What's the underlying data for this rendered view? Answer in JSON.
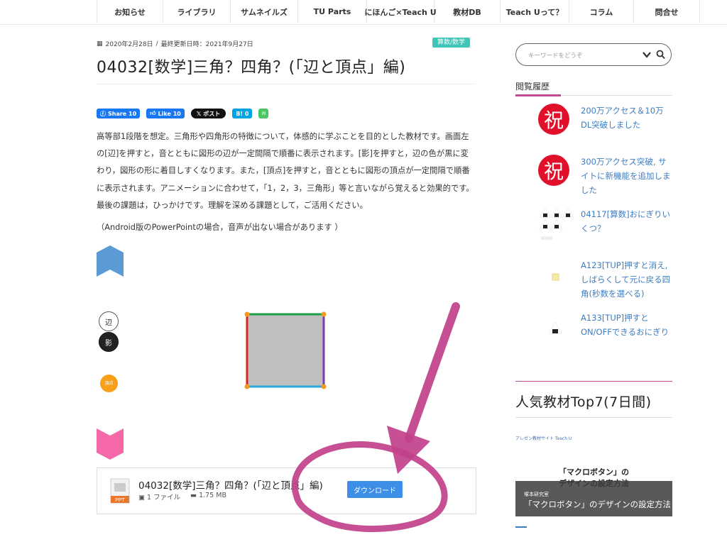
{
  "nav": {
    "items": [
      {
        "label": "お知らせ",
        "w": 92
      },
      {
        "label": "ライブラリ",
        "w": 94
      },
      {
        "label": "サムネイルズ",
        "w": 94
      },
      {
        "label": "TU Parts",
        "w": 96
      },
      {
        "label": "にほんご×Teach U",
        "w": 94
      },
      {
        "label": "教材DB",
        "w": 92
      },
      {
        "label": "Teach Uって？",
        "w": 96
      },
      {
        "label": "コラム",
        "w": 90
      },
      {
        "label": "問合せ",
        "w": 92
      }
    ]
  },
  "post": {
    "date": "2020年2月28日",
    "updated": "最終更新日時：2021年9月27日",
    "category": "算数/数学",
    "title": "04032[数学]三角？四角？(「辺と頂点」編)",
    "description": "高等部1段階を想定。三角形や四角形の特徴について，体感的に学ぶことを目的とした教材です。画面左の[辺]を押すと，音とともに図形の辺が一定間隔で順番に表示されます。[影]を押すと，辺の色が黒に変わり，図形の形に着目しすくなります。また，[頂点]を押すと，音とともに図形の頂点が一定間隔で順番に表示されます。アニメーションに合わせて，「1，2，3，三角形」等と言いながら覚えると効果的です。最後の課題は，ひっかけです。理解を深める課題として，ご活用ください。",
    "note": "（Android版のPowerPointの場合，音声が出ない場合があります ）"
  },
  "share": {
    "fb": "Share 10",
    "like": "Like 10",
    "x": "ポスト",
    "hatena": "B! 0",
    "line": "LINE"
  },
  "slide": {
    "btn_hen": "辺",
    "btn_kage": "影",
    "btn_choten": "頂点"
  },
  "download": {
    "title": "04032[数学]三角？四角？(「辺と頂点」編)",
    "files": "1 ファイル",
    "size": "1.75 MB",
    "button": "ダウンロード",
    "filetype": "PPT"
  },
  "sidebar": {
    "search_placeholder": "キーワードをどうぞ",
    "history_heading": "閲覧履歴",
    "history": [
      {
        "text": "200万アクセス＆10万DL突破しました",
        "thumb": "祝"
      },
      {
        "text": "300万アクセス突破, サイトに新機能を追加しました",
        "thumb": "祝"
      },
      {
        "text": "04117[算数]おにぎりいくつ？",
        "thumb": "onigiri"
      },
      {
        "text": "A123[TUP]押すと消え, しばらくして元に戻る四角(秒数を選べる)",
        "thumb": "square"
      },
      {
        "text": "A133[TUP]押すとON/OFFできるおにぎり",
        "thumb": "onigiri1"
      }
    ],
    "popular_heading": "人気教材Top7(7日間)",
    "popular_card": {
      "logo": "アレゼン教材サイト Teach U",
      "big": "「マクロボタン」の\nデザインの設定方法",
      "overlay_small": "塚本研究室",
      "overlay_big": "「マクロボタン」のデザインの設定方法"
    }
  },
  "colors": {
    "accent": "#c04c94",
    "link": "#3b7dc2",
    "badge": "#3cc5b8",
    "download_btn": "#3c8ee6",
    "annotation": "#c2418b"
  }
}
